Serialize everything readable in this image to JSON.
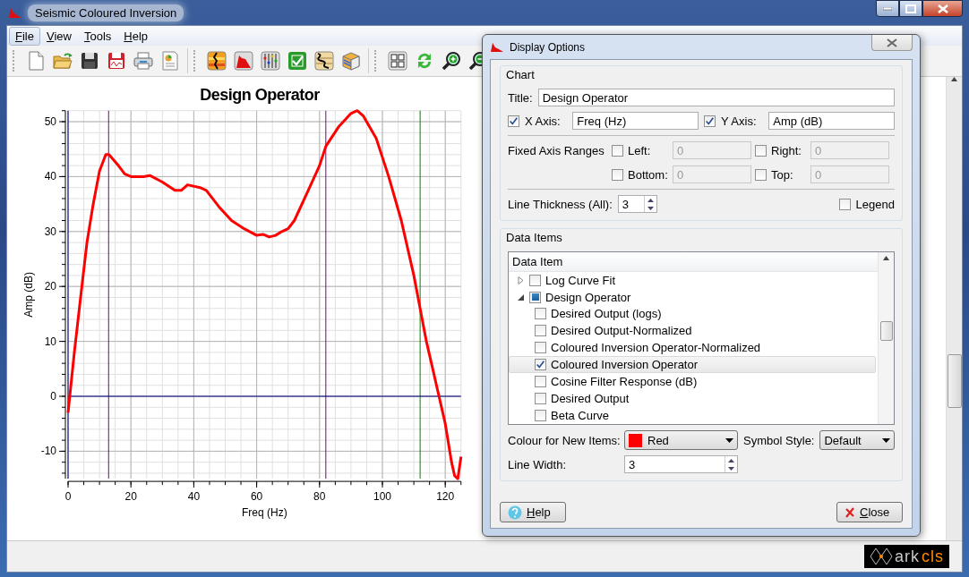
{
  "window": {
    "title": "Seismic Coloured Inversion"
  },
  "menu": [
    {
      "label": "File",
      "selected": true
    },
    {
      "label": "View",
      "selected": false
    },
    {
      "label": "Tools",
      "selected": false
    },
    {
      "label": "Help",
      "selected": false
    }
  ],
  "chart": {
    "chart_data": {
      "type": "line",
      "grid": true,
      "title": "Design Operator",
      "xlabel": "Freq (Hz)",
      "ylabel": "Amp (dB)",
      "xlim": [
        0,
        125
      ],
      "ylim": [
        -15,
        52
      ],
      "xticks": [
        0,
        20,
        40,
        60,
        80,
        100,
        120
      ],
      "yticks": [
        -10,
        0,
        10,
        20,
        30,
        40,
        50
      ],
      "x": [
        0,
        2,
        4,
        6,
        8,
        10,
        12,
        13,
        16,
        18,
        20,
        24,
        26,
        30,
        34,
        36,
        38,
        42,
        44,
        48,
        52,
        56,
        60,
        62,
        64,
        66,
        68,
        70,
        72,
        76,
        80,
        82,
        86,
        90,
        92,
        94,
        98,
        102,
        106,
        110,
        112,
        114,
        116,
        118,
        120,
        122,
        123,
        124,
        125
      ],
      "series": [
        {
          "color": "#ff0000",
          "values": [
            -3,
            8,
            18,
            28,
            35,
            41,
            44,
            44,
            42,
            40.5,
            40,
            40,
            40.2,
            39,
            37.5,
            37.5,
            38.5,
            38,
            37.5,
            34.5,
            32,
            30.5,
            29.3,
            29.5,
            29,
            29.3,
            30,
            30.5,
            32,
            37,
            42,
            45.5,
            49,
            51.5,
            52,
            51,
            47,
            40,
            32,
            22,
            16,
            10,
            5,
            0,
            -5,
            -12,
            -14.5,
            -15,
            -11
          ]
        }
      ],
      "ref_lines": [
        {
          "axis": "x",
          "value": 0,
          "color": "#000080"
        },
        {
          "axis": "x",
          "value": 12.9,
          "color": "#800080"
        },
        {
          "axis": "x",
          "value": 82,
          "color": "#800080"
        },
        {
          "axis": "x",
          "value": 112,
          "color": "#008000"
        },
        {
          "axis": "y",
          "value": 0,
          "color": "#000080"
        }
      ]
    }
  },
  "dialog": {
    "title": "Display Options",
    "chart_group": {
      "label": "Chart",
      "title_label": "Title:",
      "title_value": "Design Operator",
      "axes": [
        {
          "label": "X Axis:",
          "checked": true,
          "value": "Freq (Hz)"
        },
        {
          "label": "Y Axis:",
          "checked": true,
          "value": "Amp (dB)"
        }
      ],
      "ranges_label": "Fixed Axis Ranges",
      "ranges": [
        {
          "label": "Left:",
          "checked": false,
          "value": "0",
          "disabled": true
        },
        {
          "label": "Right:",
          "checked": false,
          "value": "0",
          "disabled": true
        },
        {
          "label": "Bottom:",
          "checked": false,
          "value": "0",
          "disabled": true
        },
        {
          "label": "Top:",
          "checked": false,
          "value": "0",
          "disabled": true
        }
      ],
      "thickness_label": "Line Thickness (All):",
      "thickness_value": "3",
      "legend": {
        "label": "Legend",
        "checked": false
      }
    },
    "data_group": {
      "label": "Data Items",
      "column": "Data Item",
      "tree": [
        {
          "label": "Log Curve Fit",
          "checked": false,
          "partial": false,
          "expanded": false,
          "selected": false
        },
        {
          "label": "Design Operator",
          "checked": false,
          "partial": true,
          "expanded": true,
          "selected": false,
          "children": [
            {
              "label": "Desired Output (logs)",
              "checked": false,
              "selected": false
            },
            {
              "label": "Desired Output-Normalized",
              "checked": false,
              "selected": false
            },
            {
              "label": "Coloured Inversion Operator-Normalized",
              "checked": false,
              "selected": false
            },
            {
              "label": "Coloured Inversion Operator",
              "checked": true,
              "selected": true
            },
            {
              "label": "Cosine Filter Response (dB)",
              "checked": false,
              "selected": false
            },
            {
              "label": "Desired Output",
              "checked": false,
              "selected": false
            },
            {
              "label": "Beta Curve",
              "checked": false,
              "selected": false
            }
          ]
        }
      ],
      "colour_label": "Colour for New Items:",
      "colour": {
        "value": "Red",
        "color": "#ff0000"
      },
      "symbol_label": "Symbol Style:",
      "symbol_value": "Default",
      "width_label": "Line Width:",
      "width_value": "3"
    },
    "buttons": [
      {
        "label": "Help",
        "kind": "help"
      },
      {
        "label": "Close",
        "kind": "close"
      }
    ]
  },
  "status_bar": {
    "logo": {
      "part_1": "ark",
      "part_2": "cls"
    }
  }
}
